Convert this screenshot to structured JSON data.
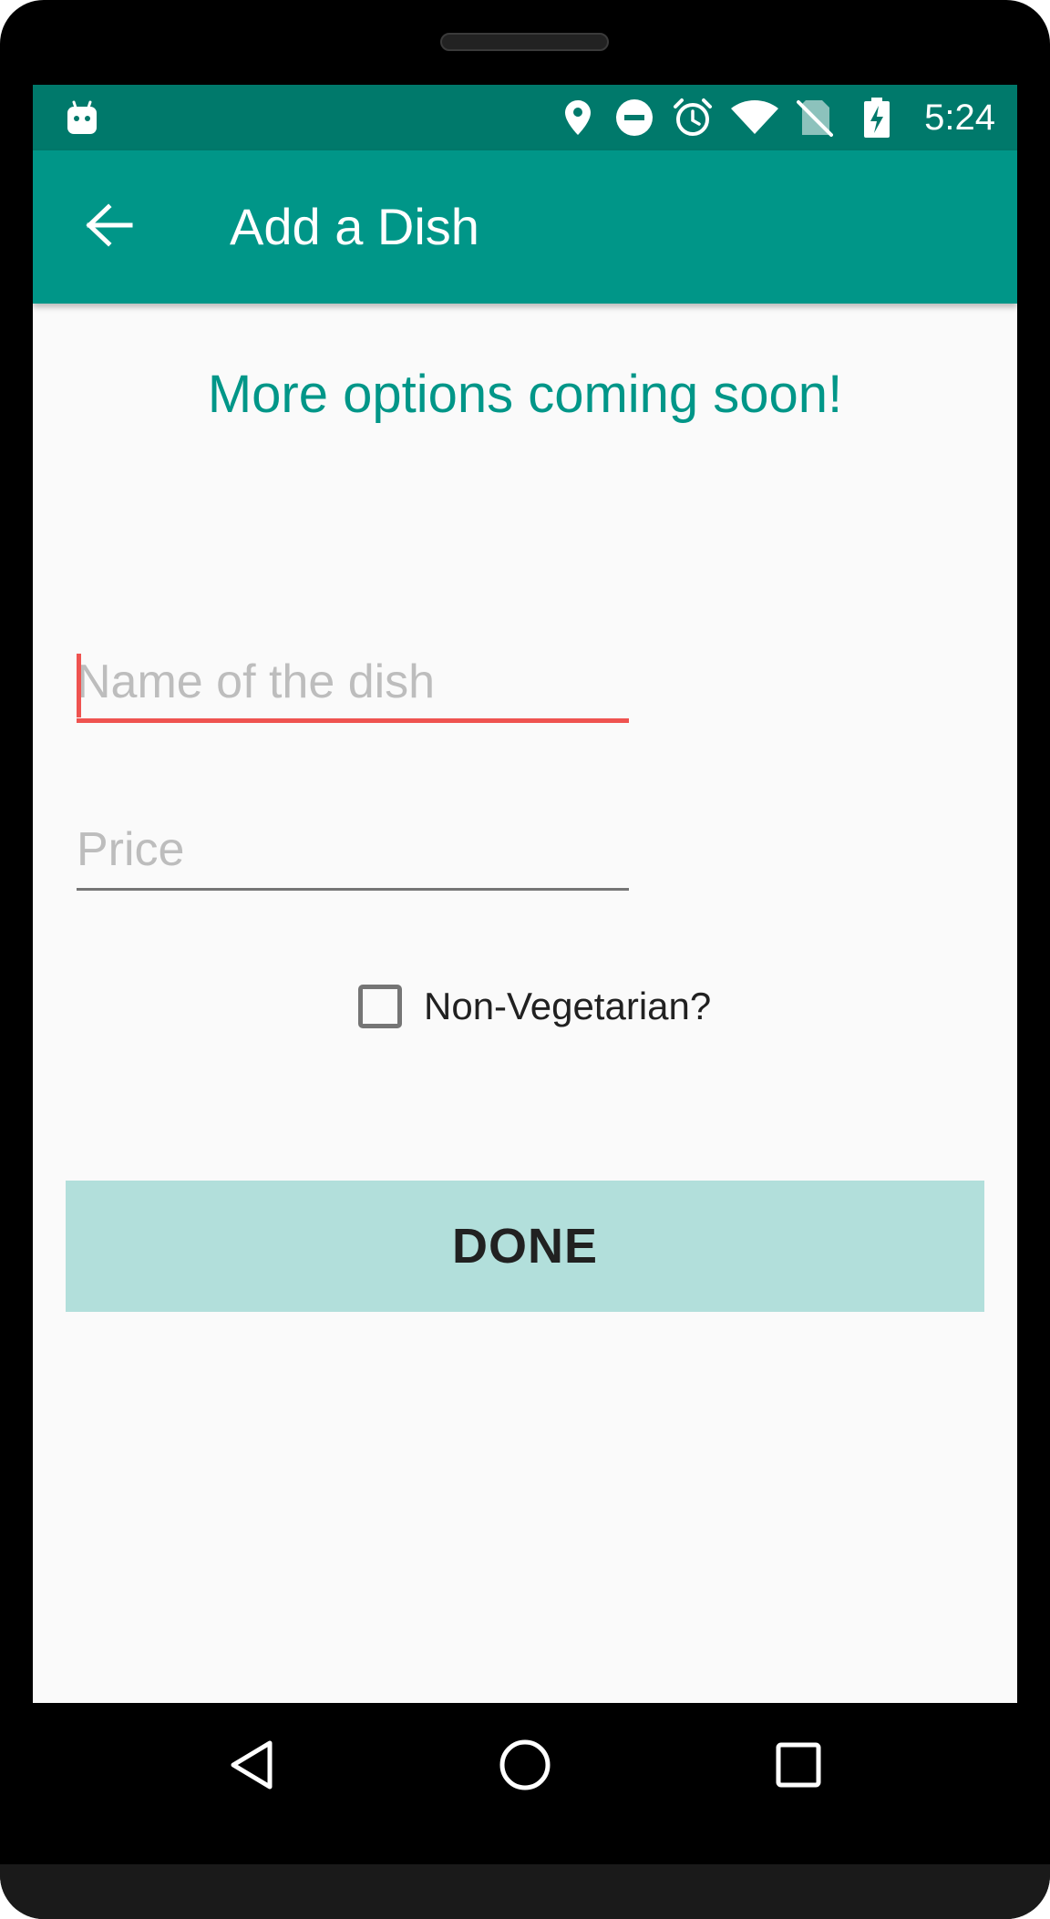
{
  "status_bar": {
    "time": "5:24",
    "icons": [
      "android-notification-icon",
      "location-icon",
      "do-not-disturb-icon",
      "alarm-icon",
      "wifi-icon",
      "no-sim-icon",
      "battery-charging-icon"
    ]
  },
  "app_bar": {
    "title": "Add a Dish",
    "back_icon": "arrow-back-icon"
  },
  "main": {
    "headline": "More options coming soon!",
    "name_field": {
      "placeholder": "Name of the dish",
      "value": ""
    },
    "price_field": {
      "placeholder": "Price",
      "value": ""
    },
    "non_veg_checkbox": {
      "label": "Non-Vegetarian?",
      "checked": false
    },
    "done_button": {
      "label": "DONE"
    }
  },
  "nav_bar": {
    "buttons": [
      "back-triangle-icon",
      "home-circle-icon",
      "recents-square-icon"
    ]
  },
  "colors": {
    "status_bar": "#00796b",
    "primary": "#009688",
    "accent_error": "#ef5350",
    "button_bg": "#b2dfdb",
    "background": "#fafafa"
  }
}
